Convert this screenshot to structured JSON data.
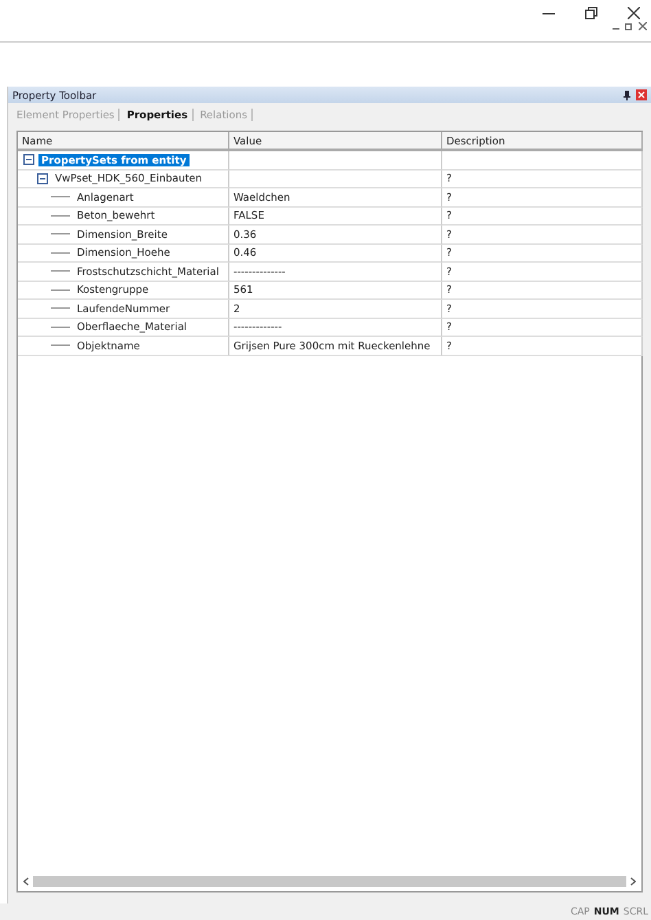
{
  "panel": {
    "title": "Property Toolbar"
  },
  "tabs": [
    {
      "label": "Element Properties",
      "selected": false
    },
    {
      "label": "Properties",
      "selected": true
    },
    {
      "label": "Relations",
      "selected": false
    }
  ],
  "table": {
    "columns": [
      "Name",
      "Value",
      "Description"
    ],
    "rows": [
      {
        "name": "PropertySets from entity",
        "expanded": true,
        "selected": true,
        "children": [
          {
            "name": "VwPset_HDK_560_Einbauten",
            "description": "?",
            "expanded": true,
            "selected": false,
            "children": [
              {
                "name": "Anlagenart",
                "value": "Waeldchen",
                "description": "?",
                "selected": false
              },
              {
                "name": "Beton_bewehrt",
                "value": "FALSE",
                "description": "?",
                "selected": false
              },
              {
                "name": "Dimension_Breite",
                "value": "0.36",
                "description": "?",
                "selected": false
              },
              {
                "name": "Dimension_Hoehe",
                "value": "0.46",
                "description": "?",
                "selected": false
              },
              {
                "name": "Frostschutzschicht_Material",
                "value": "--------------",
                "description": "?",
                "selected": false
              },
              {
                "name": "Kostengruppe",
                "value": "561",
                "description": "?",
                "selected": false
              },
              {
                "name": "LaufendeNummer",
                "value": "2",
                "description": "?",
                "selected": false
              },
              {
                "name": "Oberflaeche_Material",
                "value": "-------------",
                "description": "?",
                "selected": false
              },
              {
                "name": "Objektname",
                "value": "Grijsen Pure 300cm mit Rueckenlehne",
                "description": "?",
                "selected": false
              }
            ]
          }
        ]
      }
    ]
  },
  "status_bar": [
    {
      "label": "CAP",
      "on": false
    },
    {
      "label": "NUM",
      "on": true
    },
    {
      "label": "SCRL",
      "on": false
    }
  ]
}
